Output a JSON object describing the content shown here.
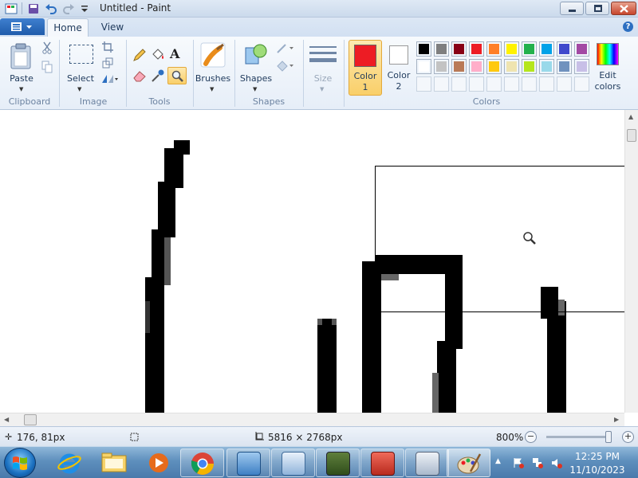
{
  "window": {
    "title": "Untitled - Paint"
  },
  "tabs": [
    {
      "label": "Home",
      "active": true
    },
    {
      "label": "View",
      "active": false
    }
  ],
  "ribbon": {
    "clipboard": {
      "paste_label": "Paste",
      "group_label": "Clipboard"
    },
    "image": {
      "select_label": "Select",
      "group_label": "Image"
    },
    "tools": {
      "group_label": "Tools"
    },
    "brushes": {
      "label": "Brushes"
    },
    "shapes": {
      "label": "Shapes",
      "group_label": "Shapes"
    },
    "size": {
      "label": "Size"
    },
    "colors": {
      "color1_label_line1": "Color",
      "color1_label_line2": "1",
      "color2_label_line1": "Color",
      "color2_label_line2": "2",
      "edit_label_line1": "Edit",
      "edit_label_line2": "colors",
      "group_label": "Colors",
      "color1_value": "#ed1c24",
      "color2_value": "#ffffff",
      "palette_row1": [
        "#000000",
        "#7f7f7f",
        "#880015",
        "#ed1c24",
        "#ff7f27",
        "#fff200",
        "#22b14c",
        "#00a2e8",
        "#3f48cc",
        "#a349a4"
      ],
      "palette_row2": [
        "#ffffff",
        "#c3c3c3",
        "#b97a57",
        "#ffaec9",
        "#ffc90e",
        "#efe4b0",
        "#b5e61d",
        "#99d9ea",
        "#7092be",
        "#c8bfe7"
      ],
      "palette_row3": [
        "#ffffff",
        "#ffffff",
        "#ffffff",
        "#ffffff",
        "#ffffff",
        "#ffffff",
        "#ffffff",
        "#ffffff",
        "#ffffff",
        "#ffffff"
      ]
    }
  },
  "status": {
    "cursor_pos": "176, 81px",
    "image_size": "5816 × 2768px",
    "zoom": "800%"
  },
  "taskbar": {
    "time": "12:25 PM",
    "date": "11/10/2023",
    "apps": [
      "internet-explorer",
      "file-explorer",
      "media-player",
      "chrome",
      "control-panel",
      "remote-desktop",
      "task-manager",
      "toolbox",
      "calculator",
      "paint"
    ]
  }
}
